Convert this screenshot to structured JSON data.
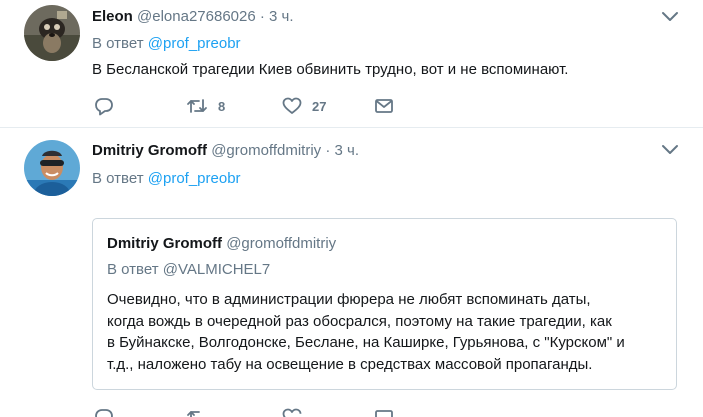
{
  "tweets": [
    {
      "name": "Eleon",
      "handle": "@elona27686026",
      "separator": "·",
      "time": "3 ч.",
      "reply_prefix": "В ответ",
      "reply_to": "@prof_preobr",
      "text": "В Бесланской трагедии Киев обвинить трудно, вот и не вспоминают.",
      "retweets": "8",
      "likes": "27"
    },
    {
      "name": "Dmitriy Gromoff",
      "handle": "@gromoffdmitriy",
      "separator": "·",
      "time": "3 ч.",
      "reply_prefix": "В ответ",
      "reply_to": "@prof_preobr",
      "quote": {
        "name": "Dmitriy Gromoff",
        "handle": "@gromoffdmitriy",
        "reply_line": "В ответ @VALMICHEL7",
        "lines": [
          "Очевидно, что в администрации фюрера не любят вспоминать даты,",
          "когда вождь в очередной раз обосрался, поэтому на такие трагедии, как",
          "в Буйнакске, Волгодонске, Беслане, на Каширке, Гурьянова, с \"Курском\" и",
          "т.д., наложено табу на освещение в средствах массовой пропаганды."
        ]
      }
    }
  ],
  "icons": {
    "reply": "reply-icon",
    "retweet": "retweet-icon",
    "like": "heart-icon",
    "message": "envelope-icon",
    "more": "chevron-down-icon"
  },
  "colors": {
    "link": "#1da1f2",
    "muted": "#657786",
    "text": "#14171a",
    "border": "#e6ecf0"
  }
}
